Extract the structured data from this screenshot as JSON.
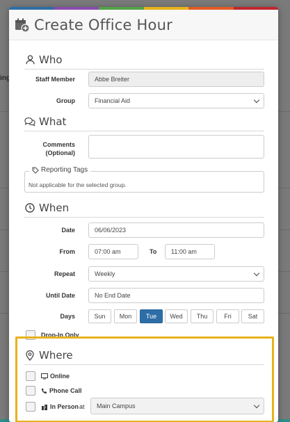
{
  "background": {
    "partial_label": "ing"
  },
  "modal": {
    "title": "Create Office Hour",
    "rainbow_colors": [
      "#2e6ea6",
      "#8a4bb0",
      "#52a347",
      "#e9b21a",
      "#e35b24",
      "#c1272d"
    ]
  },
  "who": {
    "heading": "Who",
    "staff_label": "Staff Member",
    "staff_value": "Abbe Breiter",
    "group_label": "Group",
    "group_value": "Financial Aid"
  },
  "what": {
    "heading": "What",
    "comments_label_line1": "Comments",
    "comments_label_line2": "(Optional)",
    "comments_value": "",
    "tags_legend": "Reporting Tags",
    "tags_text": "Not applicable for the selected group."
  },
  "when": {
    "heading": "When",
    "date_label": "Date",
    "date_value": "06/06/2023",
    "from_label": "From",
    "from_value": "07:00 am",
    "to_label": "To",
    "to_value": "11:00 am",
    "repeat_label": "Repeat",
    "repeat_value": "Weekly",
    "until_label": "Until Date",
    "until_placeholder": "No End Date",
    "days_label": "Days",
    "days": [
      "Sun",
      "Mon",
      "Tue",
      "Wed",
      "Thu",
      "Fri",
      "Sat"
    ],
    "selected_day": "Tue",
    "dropin_label": "Drop-In Only"
  },
  "where": {
    "heading": "Where",
    "online_label": "Online",
    "phone_label": "Phone Call",
    "inperson_label": "In Person",
    "at_label": "at",
    "location_value": "Main Campus"
  },
  "colors": {
    "highlight": "#e8b21c",
    "active_day": "#2e6ea6"
  }
}
